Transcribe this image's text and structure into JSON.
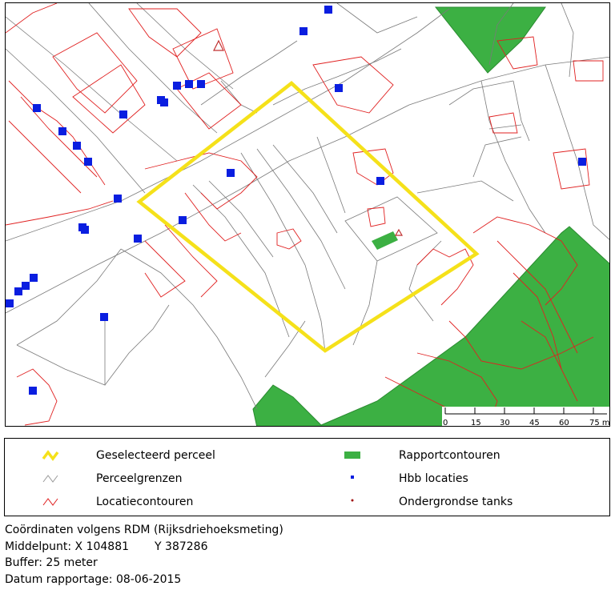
{
  "legend": {
    "items": [
      {
        "id": "geselecteerd",
        "label": "Geselecteerd perceel",
        "color": "#f0e010"
      },
      {
        "id": "perceelgrenzen",
        "label": "Perceelgrenzen",
        "color": "#9a9a9a"
      },
      {
        "id": "locatiecontouren",
        "label": "Locatiecontouren",
        "color": "#e02020"
      },
      {
        "id": "rapportcontouren",
        "label": "Rapportcontouren",
        "color": "#3cb043"
      },
      {
        "id": "hbb",
        "label": "Hbb locaties",
        "color": "#0a1ee0"
      },
      {
        "id": "tanks",
        "label": "Ondergrondse tanks",
        "color": "#a01010"
      }
    ]
  },
  "scalebar": {
    "ticks": [
      "0",
      "15",
      "30",
      "45",
      "60",
      "75 m"
    ]
  },
  "meta": {
    "line1": "Coördinaten volgens RDM (Rijksdriehoeksmeting)",
    "line2_prefix": "Middelpunt: X 104881",
    "line2_y": "Y 387286",
    "line3": "Buffer: 25 meter",
    "line4": "Datum rapportage: 08-06-2015"
  },
  "colors": {
    "parcel": "#7a7a7a",
    "contour": "#e02020",
    "green": "#3cb043",
    "yellow": "#f5e11a",
    "blue": "#0a1ee0"
  }
}
